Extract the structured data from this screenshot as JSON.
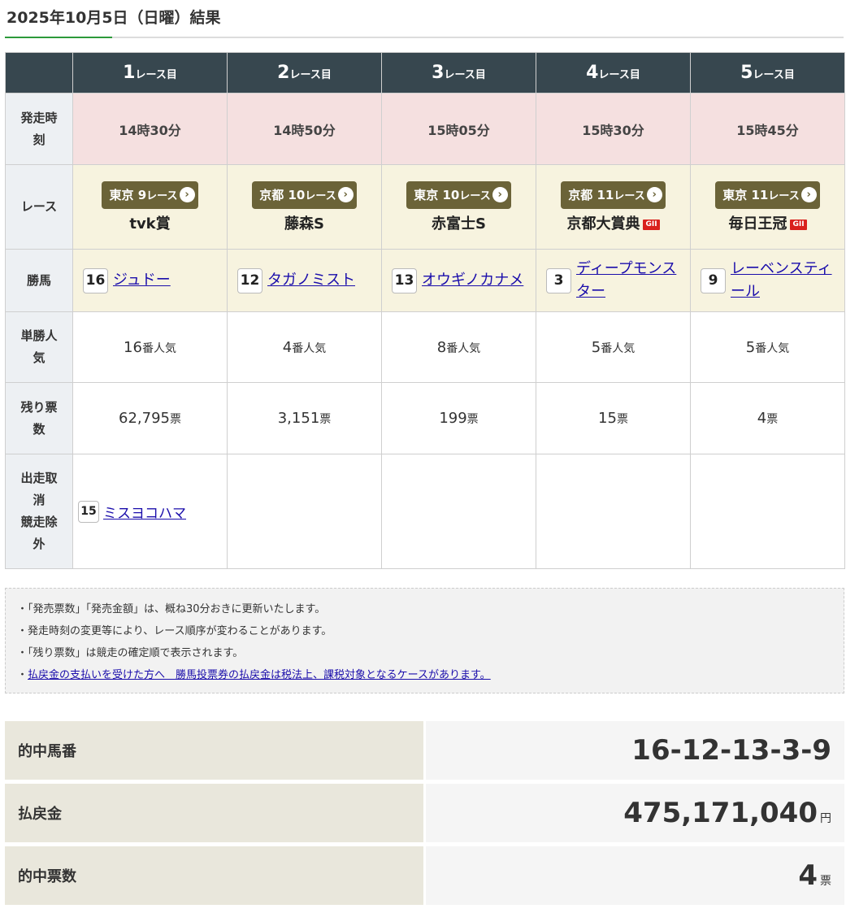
{
  "page": {
    "title": "2025年10月5日（日曜）結果"
  },
  "table": {
    "race_unit": "レース目",
    "races": [
      {
        "num": "1",
        "time": "14時30分",
        "venue": "東京",
        "venue_race_num": "9",
        "venue_race_unit": "レース",
        "race_name": "tvk賞",
        "grade": "",
        "winner_num": "16",
        "winner_name": "ジュドー",
        "popularity_num": "16",
        "popularity_unit": "番人気",
        "remaining": "62,795",
        "remaining_unit": "票",
        "scratch_num": "15",
        "scratch_name": "ミスヨコハマ"
      },
      {
        "num": "2",
        "time": "14時50分",
        "venue": "京都",
        "venue_race_num": "10",
        "venue_race_unit": "レース",
        "race_name": "藤森S",
        "grade": "",
        "winner_num": "12",
        "winner_name": "タガノミスト",
        "popularity_num": "4",
        "popularity_unit": "番人気",
        "remaining": "3,151",
        "remaining_unit": "票",
        "scratch_num": "",
        "scratch_name": ""
      },
      {
        "num": "3",
        "time": "15時05分",
        "venue": "東京",
        "venue_race_num": "10",
        "venue_race_unit": "レース",
        "race_name": "赤富士S",
        "grade": "",
        "winner_num": "13",
        "winner_name": "オウギノカナメ",
        "popularity_num": "8",
        "popularity_unit": "番人気",
        "remaining": "199",
        "remaining_unit": "票",
        "scratch_num": "",
        "scratch_name": ""
      },
      {
        "num": "4",
        "time": "15時30分",
        "venue": "京都",
        "venue_race_num": "11",
        "venue_race_unit": "レース",
        "race_name": "京都大賞典",
        "grade": "GII",
        "winner_num": "3",
        "winner_name": "ディープモンスター",
        "popularity_num": "5",
        "popularity_unit": "番人気",
        "remaining": "15",
        "remaining_unit": "票",
        "scratch_num": "",
        "scratch_name": ""
      },
      {
        "num": "5",
        "time": "15時45分",
        "venue": "東京",
        "venue_race_num": "11",
        "venue_race_unit": "レース",
        "race_name": "毎日王冠",
        "grade": "GII",
        "winner_num": "9",
        "winner_name": "レーベンスティール",
        "popularity_num": "5",
        "popularity_unit": "番人気",
        "remaining": "4",
        "remaining_unit": "票",
        "scratch_num": "",
        "scratch_name": ""
      }
    ],
    "row_headers": {
      "time_1": "発走時",
      "time_2": "刻",
      "race": "レース",
      "winner": "勝馬",
      "pop_1": "単勝人",
      "pop_2": "気",
      "rem_1": "残り票",
      "rem_2": "数",
      "scratch_1": "出走取",
      "scratch_2": "消",
      "scratch_3": "競走除",
      "scratch_4": "外"
    }
  },
  "notes": {
    "bullet": "・",
    "items": [
      "「発売票数」「発売金額」は、概ね30分おきに更新いたします。",
      "発走時刻の変更等により、レース順序が変わることがあります。",
      "「残り票数」は競走の確定順で表示されます。"
    ],
    "link": "払戻金の支払いを受けた方へ　勝馬投票券の払戻金は税法上、課税対象となるケースがあります。"
  },
  "summary": {
    "hit_label": "的中馬番",
    "hit_value": "16-12-13-3-9",
    "payout_label": "払戻金",
    "payout_value": "475,171,040",
    "payout_unit": "円",
    "tickets_label": "的中票数",
    "tickets_value": "4",
    "tickets_unit": "票"
  }
}
